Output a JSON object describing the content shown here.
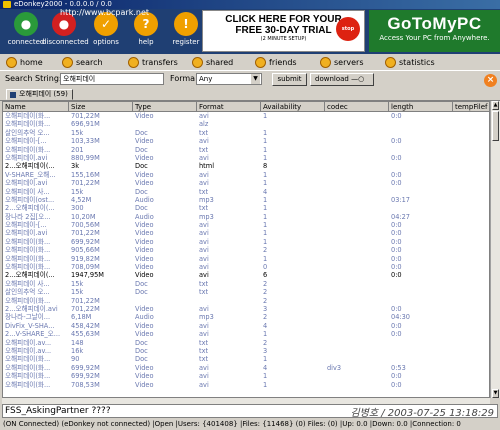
{
  "window": {
    "title": "eDonkey2000 - 0.0.0.0 / 0.0"
  },
  "toolbar": [
    {
      "label": "connected",
      "icon": "connected-icon",
      "color": "#2a9a3a"
    },
    {
      "label": "disconnected",
      "icon": "disconnected-icon",
      "color": "#d22020"
    },
    {
      "label": "options",
      "icon": "options-icon",
      "color": "#f0a000"
    },
    {
      "label": "help",
      "icon": "help-icon",
      "color": "#f0a000"
    },
    {
      "label": "register",
      "icon": "register-icon",
      "color": "#f0a000"
    }
  ],
  "ads": {
    "left": {
      "line1": "CLICK HERE FOR YOUR",
      "line2": "FREE 30-DAY TRIAL",
      "line3": "(2 MINUTE SETUP)",
      "badge": "stop"
    },
    "right": {
      "brand": "GoToMyPC",
      "tagline": "Access Your PC from Anywhere."
    }
  },
  "watermark": "http://www.bcpark.net",
  "nav": [
    "home",
    "search",
    "transfers",
    "shared",
    "friends",
    "servers",
    "statistics"
  ],
  "search": {
    "label": "Search String:",
    "value": "오해피데이",
    "format_label": "Forma",
    "format_value": "Any",
    "submit": "submit",
    "download": "download"
  },
  "tab": {
    "label": "오해피데이 (59)"
  },
  "columns": [
    "Name",
    "Size",
    "Type",
    "Format",
    "Availability",
    "codec",
    "length",
    "tempFilef"
  ],
  "rows": [
    [
      "오해피데이(화...",
      "701,22M",
      "Video",
      "avi",
      "1",
      "",
      "0:0",
      ""
    ],
    [
      "오해피데이(화...",
      "696,91M",
      "",
      "alz",
      "",
      "",
      "",
      ""
    ],
    [
      "살인의추억 오...",
      "15k",
      "Doc",
      "txt",
      "1",
      "",
      "",
      ""
    ],
    [
      "오해피데이-[...",
      "103,33M",
      "Video",
      "avi",
      "1",
      "",
      "0:0",
      ""
    ],
    [
      "오해피데이(화...",
      "201",
      "Doc",
      "txt",
      "1",
      "",
      "",
      ""
    ],
    [
      "오해피데이.avi",
      "880,99M",
      "Video",
      "avi",
      "1",
      "",
      "0:0",
      ""
    ],
    [
      "2...오해피데이(...",
      "3k",
      "Doc",
      "html",
      "8",
      "",
      "",
      ""
    ],
    [
      "V-SHARE_오해...",
      "155,16M",
      "Video",
      "avi",
      "1",
      "",
      "0:0",
      ""
    ],
    [
      "오해피데이.avi",
      "701,22M",
      "Video",
      "avi",
      "1",
      "",
      "0:0",
      ""
    ],
    [
      "오해피데이 사...",
      "15k",
      "Doc",
      "txt",
      "4",
      "",
      "",
      ""
    ],
    [
      "오해피데이(ost...",
      "4,52M",
      "Audio",
      "mp3",
      "1",
      "",
      "03:17",
      ""
    ],
    [
      "2...오해피데이(...",
      "300",
      "Doc",
      "txt",
      "1",
      "",
      "",
      ""
    ],
    [
      "장나라 2집[오...",
      "10,20M",
      "Audio",
      "mp3",
      "1",
      "",
      "04:27",
      ""
    ],
    [
      "오해피데이-[...",
      "700,56M",
      "Video",
      "avi",
      "1",
      "",
      "0:0",
      ""
    ],
    [
      "오해피데이.avi",
      "701,22M",
      "Video",
      "avi",
      "1",
      "",
      "0:0",
      ""
    ],
    [
      "오해피데이(화...",
      "699,92M",
      "Video",
      "avi",
      "1",
      "",
      "0:0",
      ""
    ],
    [
      "오해피데이(화...",
      "905,66M",
      "Video",
      "avi",
      "2",
      "",
      "0:0",
      ""
    ],
    [
      "오해피데이(화...",
      "919,82M",
      "Video",
      "avi",
      "1",
      "",
      "0:0",
      ""
    ],
    [
      "오해피데이(화...",
      "708,09M",
      "Video",
      "avi",
      "0",
      "",
      "0:0",
      ""
    ],
    [
      "2...오해피데이(...",
      "1947,95M",
      "Video",
      "avi",
      "6",
      "",
      "0:0",
      ""
    ],
    [
      "오해피데이 사...",
      "15k",
      "Doc",
      "txt",
      "2",
      "",
      "",
      ""
    ],
    [
      "살인의추억 오...",
      "15k",
      "Doc",
      "txt",
      "2",
      "",
      "",
      ""
    ],
    [
      "오해피데이(화...",
      "701,22M",
      "",
      "",
      "2",
      "",
      "",
      ""
    ],
    [
      "2...오해피데이.avi",
      "701,22M",
      "Video",
      "avi",
      "3",
      "",
      "0:0",
      ""
    ],
    [
      "장나라-그날이...",
      "6,18M",
      "Audio",
      "mp3",
      "2",
      "",
      "04:30",
      ""
    ],
    [
      "DivFix_V-SHA...",
      "458,42M",
      "Video",
      "avi",
      "4",
      "",
      "0:0",
      ""
    ],
    [
      "2...V-SHARE_오...",
      "455,63M",
      "Video",
      "avi",
      "1",
      "",
      "0:0",
      ""
    ],
    [
      "오해피데이.av...",
      "148",
      "Doc",
      "txt",
      "2",
      "",
      "",
      ""
    ],
    [
      "오해피데이.av...",
      "16k",
      "Doc",
      "txt",
      "3",
      "",
      "",
      ""
    ],
    [
      "오해피데이(화...",
      "90",
      "Doc",
      "txt",
      "1",
      "",
      "",
      ""
    ],
    [
      "오해피데이(화...",
      "699,92M",
      "Video",
      "avi",
      "4",
      "div3",
      "0:53",
      ""
    ],
    [
      "오해피데이(화...",
      "699,92M",
      "Video",
      "avi",
      "1",
      "",
      "0:0",
      ""
    ],
    [
      "오해피데이(화...",
      "708,53M",
      "Video",
      "avi",
      "1",
      "",
      "0:0",
      ""
    ]
  ],
  "log": "FSS_AskingPartner ????",
  "stamp": "김병호 / 2003-07-25 13:18:29",
  "status": "(ON Connected) (eDonkey not connected) |Open |Users: {401408} |Files: {11468} (0) Files: (0) |Up: 0.0 |Down: 0.0 |Connection: 0"
}
